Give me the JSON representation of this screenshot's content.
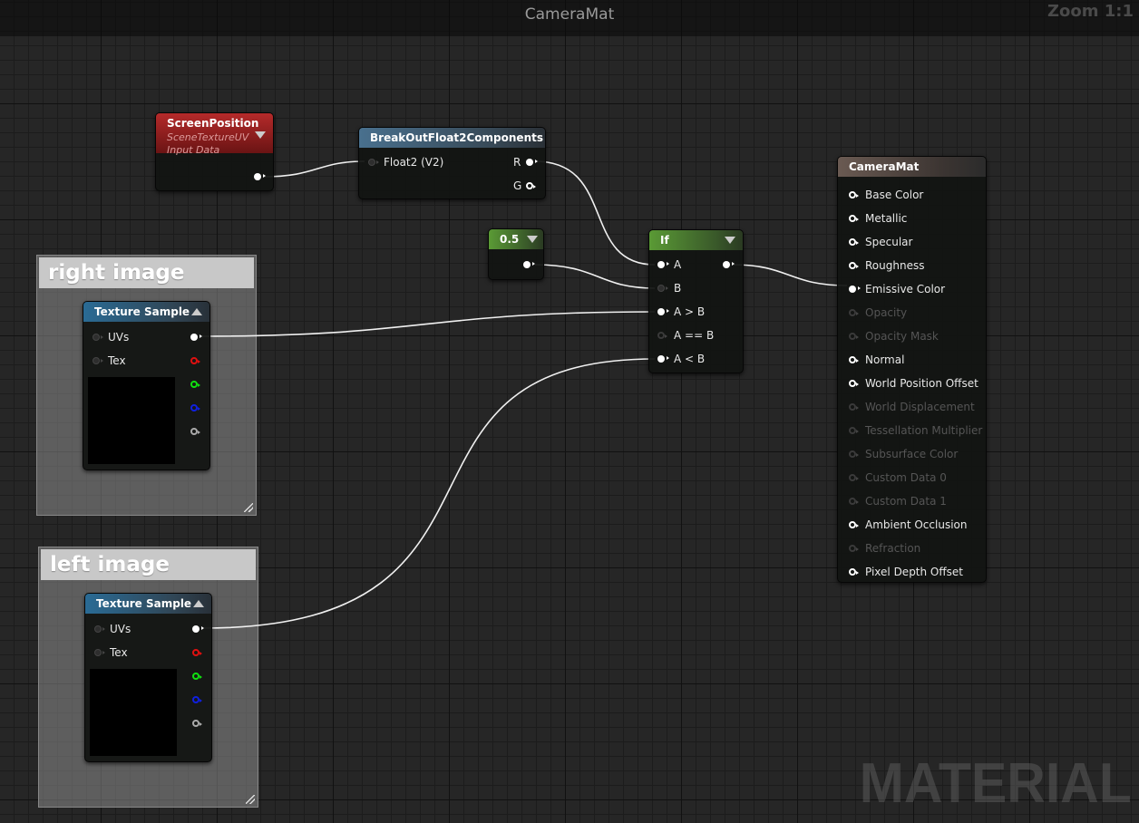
{
  "window": {
    "title": "CameraMat",
    "zoom": "Zoom 1:1",
    "watermark": "MATERIAL"
  },
  "screen_position": {
    "title": "ScreenPosition",
    "subtitle": "SceneTextureUV",
    "subtitle2": "Input Data",
    "header_color": "#b52a2a"
  },
  "breakout": {
    "title": "BreakOutFloat2Components",
    "input": "Float2 (V2)",
    "out_r": "R",
    "out_g": "G"
  },
  "constant": {
    "value": "0.5",
    "header_color": "#5a9a35"
  },
  "if_node": {
    "title": "If",
    "inputs": [
      "A",
      "B",
      "A > B",
      "A == B",
      "A < B"
    ]
  },
  "comments": {
    "right": "right image",
    "left": "left image"
  },
  "texture_sample": {
    "title": "Texture Sample",
    "uvs": "UVs",
    "tex": "Tex"
  },
  "result": {
    "title": "CameraMat",
    "pins": [
      {
        "label": "Base Color",
        "active": true
      },
      {
        "label": "Metallic",
        "active": true
      },
      {
        "label": "Specular",
        "active": true
      },
      {
        "label": "Roughness",
        "active": true
      },
      {
        "label": "Emissive Color",
        "active": true
      },
      {
        "label": "Opacity",
        "active": false
      },
      {
        "label": "Opacity Mask",
        "active": false
      },
      {
        "label": "Normal",
        "active": true
      },
      {
        "label": "World Position Offset",
        "active": true
      },
      {
        "label": "World Displacement",
        "active": false
      },
      {
        "label": "Tessellation Multiplier",
        "active": false
      },
      {
        "label": "Subsurface Color",
        "active": false
      },
      {
        "label": "Custom Data 0",
        "active": false
      },
      {
        "label": "Custom Data 1",
        "active": false
      },
      {
        "label": "Ambient Occlusion",
        "active": true
      },
      {
        "label": "Refraction",
        "active": false
      },
      {
        "label": "Pixel Depth Offset",
        "active": true
      }
    ]
  }
}
